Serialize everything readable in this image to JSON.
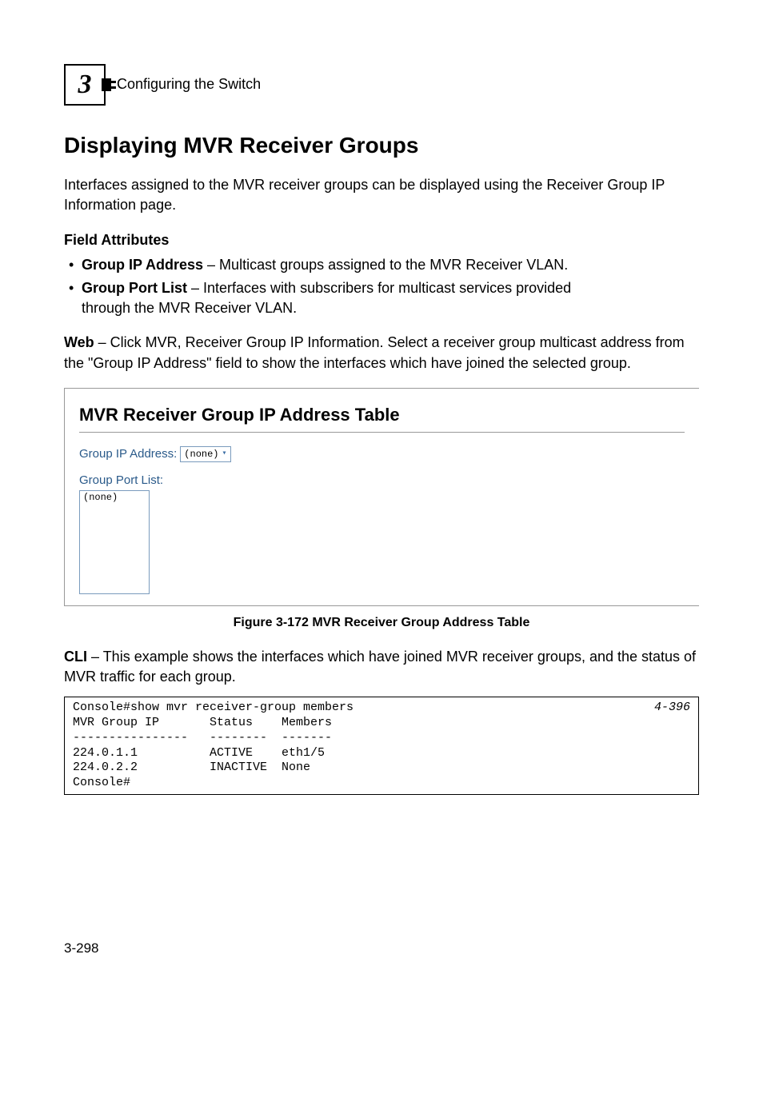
{
  "header": {
    "chapter_number": "3",
    "breadcrumb": "Configuring the Switch"
  },
  "section": {
    "title": "Displaying MVR Receiver Groups",
    "intro": "Interfaces assigned to the MVR receiver groups can be displayed using the Receiver Group IP Information page.",
    "field_attributes_heading": "Field Attributes",
    "bullets": {
      "b1_label": "Group IP Address",
      "b1_text": " – Multicast groups assigned to the MVR Receiver VLAN.",
      "b2_label": "Group Port List",
      "b2_text_line1": " – Interfaces with subscribers for multicast services provided",
      "b2_text_line2": "through the MVR Receiver VLAN."
    },
    "web_label": "Web",
    "web_text": " – Click MVR, Receiver Group IP Information. Select a receiver group multicast address from the \"Group IP Address\" field to show the interfaces which have joined the selected group."
  },
  "figure": {
    "panel_title": "MVR Receiver Group IP Address Table",
    "group_ip_label": "Group IP Address:",
    "group_ip_value": "(none)",
    "port_list_label": "Group Port List:",
    "port_list_value": "(none)",
    "caption": "Figure 3-172  MVR Receiver Group Address Table"
  },
  "cli": {
    "label": "CLI",
    "text": " – This example shows the interfaces which have joined MVR receiver groups, and the status of MVR traffic for each group.",
    "ref": "4-396",
    "line1": "Console#show mvr receiver-group members",
    "line2": "MVR Group IP       Status    Members",
    "line3": "----------------   --------  -------",
    "line4": "224.0.1.1          ACTIVE    eth1/5",
    "line5": "224.0.2.2          INACTIVE  None",
    "line6": "Console#"
  },
  "footer": {
    "page": "3-298"
  }
}
